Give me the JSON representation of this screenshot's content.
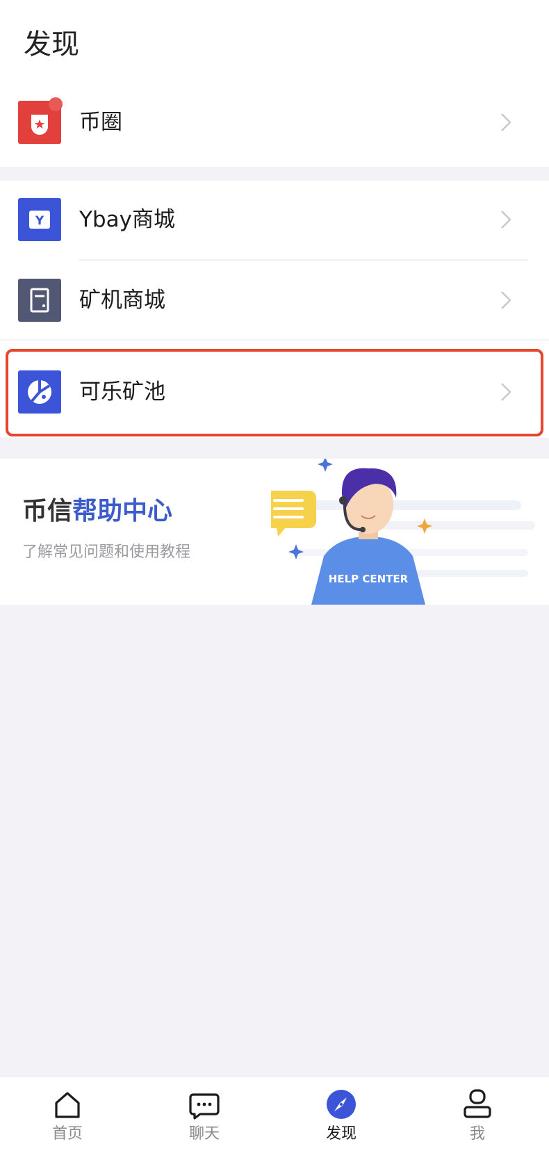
{
  "header": {
    "title": "发现"
  },
  "menu": {
    "coin_circle": {
      "label": "币圈",
      "icon": "coin-circle-icon",
      "has_badge": true,
      "badge_color": "#e85a55",
      "icon_color": "#e2403c"
    },
    "ybay_mall": {
      "label": "Ybay商城",
      "icon": "ybay-icon",
      "icon_color": "#3b54d8"
    },
    "miner_mall": {
      "label": "矿机商城",
      "icon": "miner-icon",
      "icon_color": "#525874"
    },
    "cola_pool": {
      "label": "可乐矿池",
      "icon": "cola-pool-icon",
      "icon_color": "#3b54d8",
      "highlighted": true,
      "highlight_color": "#e6452e"
    }
  },
  "help_center": {
    "title_prefix": "币信",
    "title_accent": "帮助中心",
    "subtitle": "了解常见问题和使用教程",
    "illustration_text": "HELP CENTER",
    "accent_color": "#3d5ccc"
  },
  "tabbar": {
    "items": [
      {
        "label": "首页",
        "icon": "home-icon",
        "active": false
      },
      {
        "label": "聊天",
        "icon": "chat-icon",
        "active": false
      },
      {
        "label": "发现",
        "icon": "compass-icon",
        "active": true
      },
      {
        "label": "我",
        "icon": "profile-icon",
        "active": false
      }
    ],
    "active_color": "#3b54d8"
  }
}
